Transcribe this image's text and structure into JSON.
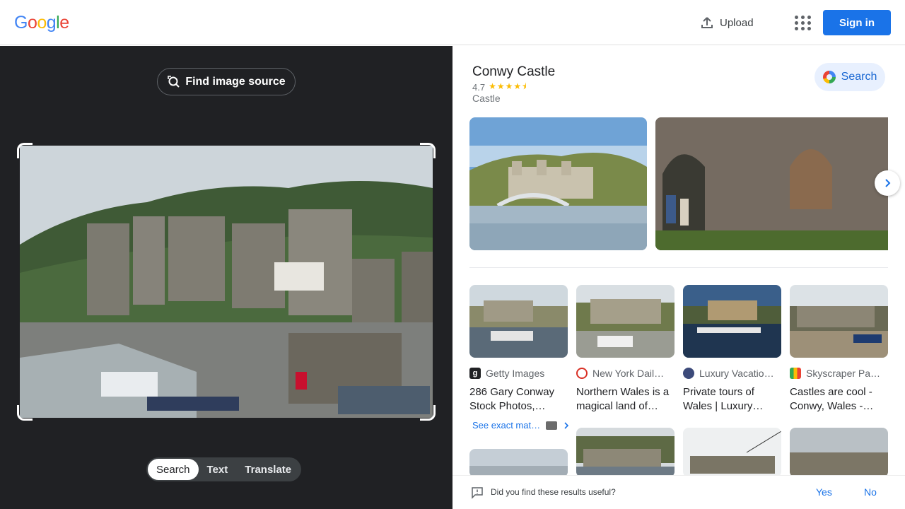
{
  "header": {
    "logo_text": "Google",
    "upload_label": "Upload",
    "apps_icon": "apps-grid-icon",
    "signin_label": "Sign in"
  },
  "left": {
    "find_source_label": "Find image source",
    "modes": [
      "Search",
      "Text",
      "Translate"
    ],
    "active_mode": "Search"
  },
  "knowledge_panel": {
    "title": "Conwy Castle",
    "rating": "4.7",
    "stars": "★★★★⯨",
    "star_value": 4.7,
    "type": "Castle",
    "search_label": "Search"
  },
  "results": [
    {
      "source": "Getty Images",
      "title": "286 Gary Conway Stock Photos,…",
      "icon_color": "#202124"
    },
    {
      "source": "New York Dail…",
      "title": "Northern Wales is a magical land of…",
      "icon_color": "#d93025"
    },
    {
      "source": "Luxury Vacatio…",
      "title": "Private tours of Wales | Luxury…",
      "icon_color": "#3c4a7a"
    },
    {
      "source": "Skyscraper Pa…",
      "title": "Castles are cool - Conwy, Wales -…",
      "icon_color": "#34a853"
    }
  ],
  "exact_matches_label": "See exact mat…",
  "feedback": {
    "question": "Did you find these results useful?",
    "yes": "Yes",
    "no": "No"
  },
  "colors": {
    "accent": "#1a73e8",
    "dark_pane": "#202124",
    "star": "#fbbc04"
  }
}
